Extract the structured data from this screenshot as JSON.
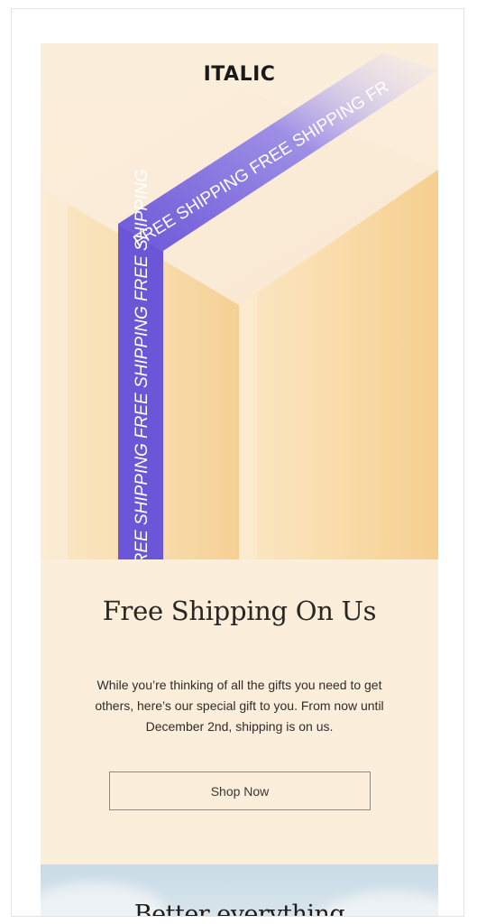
{
  "brand": {
    "logo_text": "ITALIC"
  },
  "hero": {
    "tape_text_top": "FREE SHIPPING FREE SHIPPING FR",
    "tape_text_side": "FREE SHIPPING FREE SHIPPING FREE SHIPPING",
    "tape_color": "#6a56d6"
  },
  "main": {
    "headline": "Free Shipping On Us",
    "body": "While you’re thinking of all the gifts you need to get others, here’s our special gift to you. From now until December 2nd, shipping is on us.",
    "cta_label": "Shop Now"
  },
  "next_section": {
    "headline": "Better everything"
  },
  "colors": {
    "background": "#fbeedb",
    "box_side": "#f6d49a",
    "text": "#2a2622"
  }
}
